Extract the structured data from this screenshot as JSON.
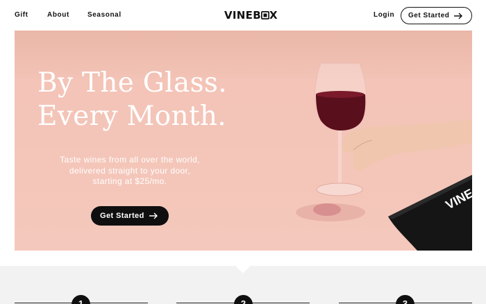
{
  "header": {
    "nav": [
      {
        "label": "Gift"
      },
      {
        "label": "About"
      },
      {
        "label": "Seasonal"
      }
    ],
    "logo_text_a": "VINEB",
    "logo_text_b": "X",
    "login_label": "Login",
    "cta_label": "Get Started"
  },
  "hero": {
    "title_line1": "By The Glass.",
    "title_line2": "Every Month.",
    "subtitle_line1": "Taste wines from all over the world,",
    "subtitle_line2": "delivered straight to your door,",
    "subtitle_line3": "starting at $25/mo.",
    "cta_label": "Get Started",
    "box_text": "VINE",
    "colors": {
      "background": "#f3c4b7",
      "wine": "#5a0f1c",
      "box": "#151515"
    }
  },
  "steps": {
    "items": [
      {
        "number": "1"
      },
      {
        "number": "2"
      },
      {
        "number": "3"
      }
    ],
    "background": "#f2f2f2"
  }
}
